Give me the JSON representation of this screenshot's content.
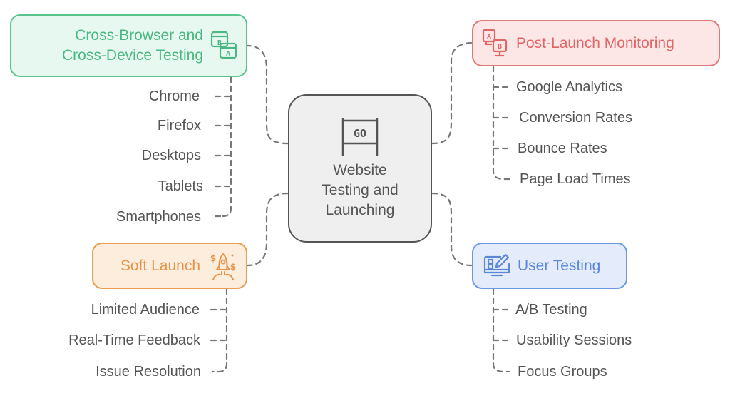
{
  "center": {
    "title_lines": [
      "Website",
      "Testing and",
      "Launching"
    ],
    "icon": "go-flag-icon",
    "icon_text": "GO"
  },
  "branches": {
    "cross_testing": {
      "title_lines": [
        "Cross-Browser and",
        "Cross-Device Testing"
      ],
      "icon": "browser-ab-icon",
      "color": "#5ac48f",
      "items": [
        "Chrome",
        "Firefox",
        "Desktops",
        "Tablets",
        "Smartphones"
      ]
    },
    "post_launch": {
      "title": "Post-Launch Monitoring",
      "icon": "monitor-ab-icon",
      "color": "#e07a7a",
      "items": [
        "Google Analytics",
        "Conversion Rates",
        "Bounce Rates",
        "Page Load Times"
      ]
    },
    "soft_launch": {
      "title": "Soft Launch",
      "icon": "rocket-money-icon",
      "color": "#eb9d52",
      "items": [
        "Limited Audience",
        "Real-Time Feedback",
        "Issue Resolution"
      ]
    },
    "user_testing": {
      "title": "User Testing",
      "icon": "monitor-edit-icon",
      "color": "#6c98e2",
      "items": [
        "A/B Testing",
        "Usability Sessions",
        "Focus Groups"
      ]
    }
  }
}
